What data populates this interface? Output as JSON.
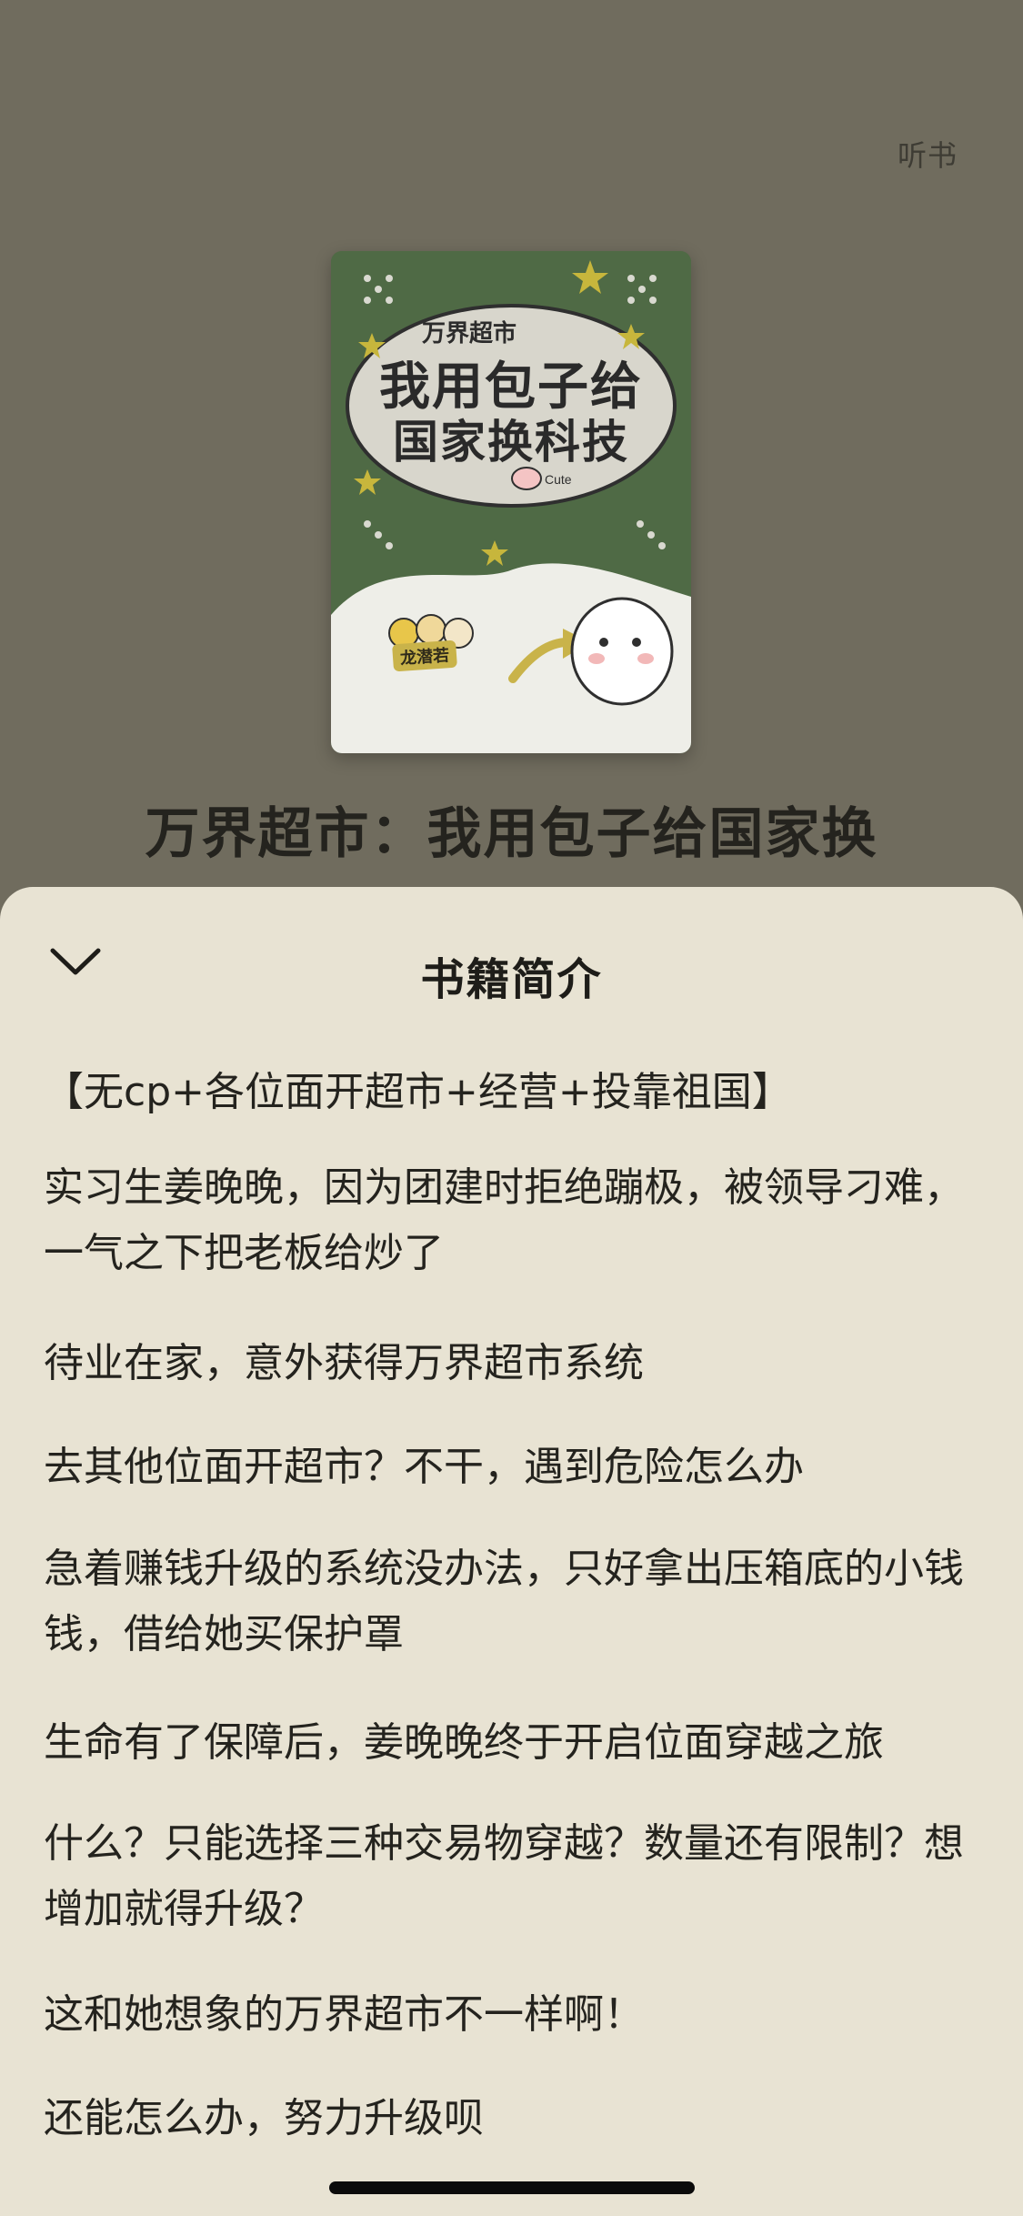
{
  "background": {
    "listen_label": "听书",
    "cover": {
      "series": "万界超市",
      "title_line1": "我用包子给",
      "title_line2": "国家换科技",
      "author": "龙潜若",
      "logo_text": "Cute"
    },
    "book_title": "万界超市：我用包子给国家换"
  },
  "sheet": {
    "title": "书籍简介",
    "paragraphs": [
      "【无cp+各位面开超市+经营+投靠祖国】",
      "实习生姜晚晚，因为团建时拒绝蹦极，被领导刁难，一气之下把老板给炒了",
      "待业在家，意外获得万界超市系统",
      "去其他位面开超市？不干，遇到危险怎么办",
      "急着赚钱升级的系统没办法，只好拿出压箱底的小钱钱，借给她买保护罩",
      "生命有了保障后，姜晚晚终于开启位面穿越之旅",
      "什么？只能选择三种交易物穿越？数量还有限制？想增加就得升级？",
      "这和她想象的万界超市不一样啊！",
      "还能怎么办，努力升级呗"
    ]
  },
  "colors": {
    "overlay_bg": "#706c5e",
    "sheet_bg": "#e8e3d3",
    "text": "#24231e",
    "cover_green": "#4f6a45"
  }
}
